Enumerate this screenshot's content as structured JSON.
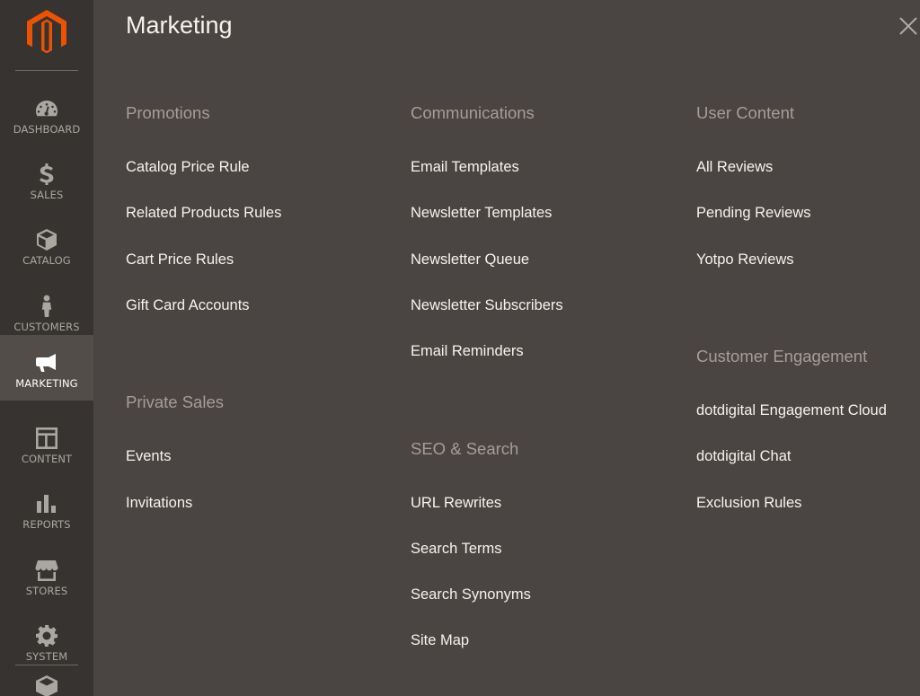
{
  "sidebar": {
    "logo_icon": "magento-logo-icon",
    "brand_color": "#eb5202",
    "items": [
      {
        "label": "DASHBOARD",
        "icon": "dashboard-icon"
      },
      {
        "label": "SALES",
        "icon": "dollar-icon"
      },
      {
        "label": "CATALOG",
        "icon": "cube-icon"
      },
      {
        "label": "CUSTOMERS",
        "icon": "person-icon"
      },
      {
        "label": "MARKETING",
        "icon": "megaphone-icon",
        "active": true
      },
      {
        "label": "CONTENT",
        "icon": "layout-icon"
      },
      {
        "label": "REPORTS",
        "icon": "bar-chart-icon"
      },
      {
        "label": "STORES",
        "icon": "storefront-icon"
      },
      {
        "label": "SYSTEM",
        "icon": "gear-icon"
      }
    ],
    "bottom_icon": "extensions-icon"
  },
  "panel": {
    "title": "Marketing",
    "close_icon": "close-icon",
    "groups": {
      "promotions": {
        "title": "Promotions",
        "links": [
          "Catalog Price Rule",
          "Related Products Rules",
          "Cart Price Rules",
          "Gift Card Accounts"
        ]
      },
      "private_sales": {
        "title": "Private Sales",
        "links": [
          "Events",
          "Invitations"
        ]
      },
      "communications": {
        "title": "Communications",
        "links": [
          "Email Templates",
          "Newsletter Templates",
          "Newsletter Queue",
          "Newsletter Subscribers",
          "Email Reminders"
        ]
      },
      "seo_search": {
        "title": "SEO & Search",
        "links": [
          "URL Rewrites",
          "Search Terms",
          "Search Synonyms",
          "Site Map"
        ]
      },
      "user_content": {
        "title": "User Content",
        "links": [
          "All Reviews",
          "Pending Reviews",
          "Yotpo Reviews"
        ]
      },
      "customer_engagement": {
        "title": "Customer Engagement",
        "links": [
          "dotdigital Engagement Cloud",
          "dotdigital Chat",
          "Exclusion Rules"
        ]
      }
    }
  }
}
